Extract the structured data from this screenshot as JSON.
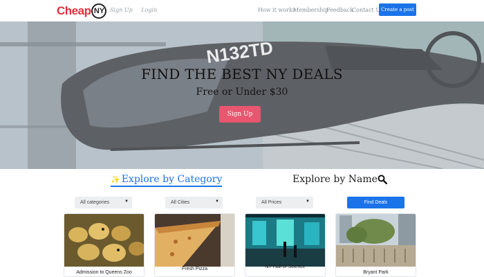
{
  "nav": {
    "logo_text": "Cheap",
    "logo_badge": "NY",
    "signup": "Sign Up",
    "login": "Login",
    "links": [
      "How it works",
      "Membership",
      "Feedback",
      "Contact Us"
    ],
    "create_post": "Create a post"
  },
  "hero": {
    "title": "FIND THE BEST NY DEALS",
    "subtitle": "Free or Under $30",
    "signup_button": "Sign Up",
    "aircraft_registration": "N132TD"
  },
  "explore": {
    "by_category": "Explore by Category",
    "by_name": "Explore by Name"
  },
  "filters": {
    "category": "All categories",
    "city": "All Cities",
    "price": "All Prices",
    "find_button": "Find Deals"
  },
  "cards": [
    {
      "title": "Admission to Queens Zoo"
    },
    {
      "title": "Fresh Pizza"
    },
    {
      "title": "NY Hall of Science"
    },
    {
      "title": "Bryant Park"
    }
  ],
  "colors": {
    "brand_red": "#e0303c",
    "accent_blue": "#1a73e8",
    "signup_pink": "#e8566f"
  }
}
